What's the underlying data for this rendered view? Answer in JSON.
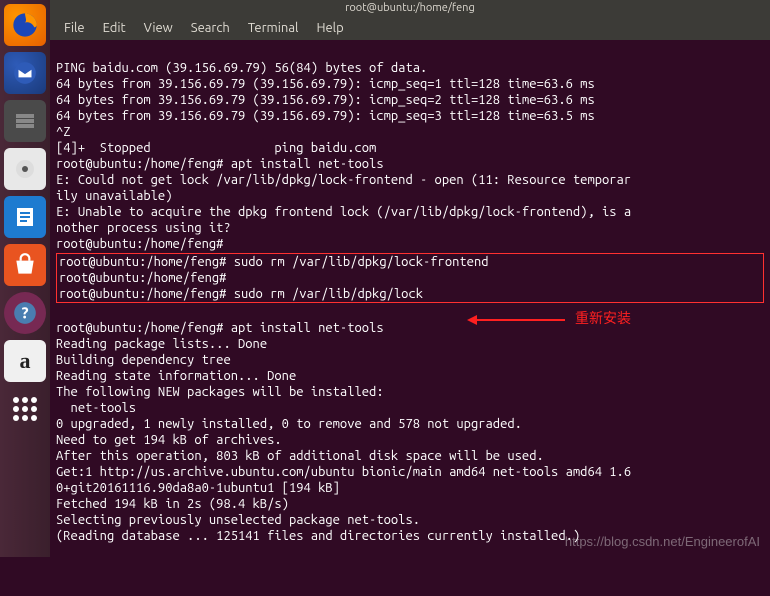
{
  "title_bar": "root@ubuntu:/home/feng",
  "menu": {
    "file": "File",
    "edit": "Edit",
    "view": "View",
    "search": "Search",
    "terminal": "Terminal",
    "help": "Help"
  },
  "launcher": {
    "firefox": "firefox-icon",
    "thunderbird": "thunderbird-icon",
    "files": "files-icon",
    "rhythmbox": "rhythmbox-icon",
    "writer": "writer-icon",
    "software": "software-icon",
    "help": "help-icon",
    "amazon": "amazon-icon",
    "apps": "apps-icon",
    "amazon_label": "a"
  },
  "term": {
    "l01": "PING baidu.com (39.156.69.79) 56(84) bytes of data.",
    "l02": "64 bytes from 39.156.69.79 (39.156.69.79): icmp_seq=1 ttl=128 time=63.6 ms",
    "l03": "64 bytes from 39.156.69.79 (39.156.69.79): icmp_seq=2 ttl=128 time=63.6 ms",
    "l04": "64 bytes from 39.156.69.79 (39.156.69.79): icmp_seq=3 ttl=128 time=63.5 ms",
    "l05": "^Z",
    "l06": "[4]+  Stopped                 ping baidu.com",
    "l07": "root@ubuntu:/home/feng# apt install net-tools",
    "l08": "E: Could not get lock /var/lib/dpkg/lock-frontend - open (11: Resource temporar",
    "l09": "ily unavailable)",
    "l10": "E: Unable to acquire the dpkg frontend lock (/var/lib/dpkg/lock-frontend), is a",
    "l11": "nother process using it?",
    "l12": "root@ubuntu:/home/feng#",
    "l13": "root@ubuntu:/home/feng# sudo rm /var/lib/dpkg/lock-frontend",
    "l14": "root@ubuntu:/home/feng#",
    "l15": "root@ubuntu:/home/feng# sudo rm /var/lib/dpkg/lock",
    "l16": "root@ubuntu:/home/feng# apt install net-tools",
    "l17": "Reading package lists... Done",
    "l18": "Building dependency tree",
    "l19": "Reading state information... Done",
    "l20": "The following NEW packages will be installed:",
    "l21": "  net-tools",
    "l22": "0 upgraded, 1 newly installed, 0 to remove and 578 not upgraded.",
    "l23": "Need to get 194 kB of archives.",
    "l24": "After this operation, 803 kB of additional disk space will be used.",
    "l25": "Get:1 http://us.archive.ubuntu.com/ubuntu bionic/main amd64 net-tools amd64 1.6",
    "l26": "0+git20161116.90da8a0-1ubuntu1 [194 kB]",
    "l27": "Fetched 194 kB in 2s (98.4 kB/s)",
    "l28": "Selecting previously unselected package net-tools.",
    "l29": "(Reading database ... 125141 files and directories currently installed.)"
  },
  "annotation": {
    "reinstall": "重新安装"
  },
  "watermark": "https://blog.csdn.net/EngineerofAI"
}
